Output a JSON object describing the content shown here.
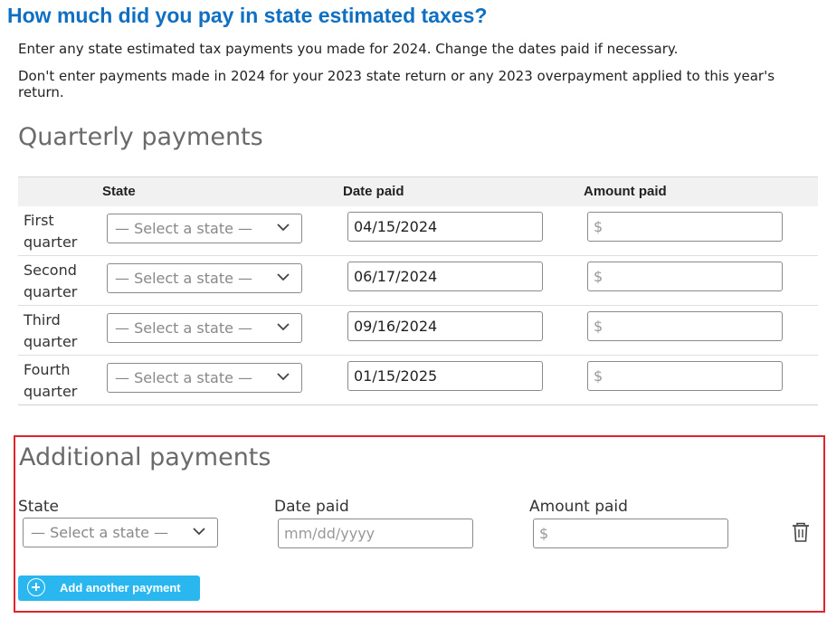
{
  "page": {
    "title": "How much did you pay in state estimated taxes?",
    "intro1": "Enter any state estimated tax payments you made for 2024. Change the dates paid if necessary.",
    "intro2": "Don't enter payments made in 2024 for your 2023 state return or any 2023 overpayment applied to this year's return."
  },
  "quarterly": {
    "title": "Quarterly payments",
    "headers": {
      "state": "State",
      "date": "Date paid",
      "amount": "Amount paid"
    },
    "rows": [
      {
        "label": "First quarter",
        "state": "— Select a state —",
        "date": "04/15/2024",
        "amount": "$"
      },
      {
        "label": "Second quarter",
        "state": "— Select a state —",
        "date": "06/17/2024",
        "amount": "$"
      },
      {
        "label": "Third quarter",
        "state": "— Select a state —",
        "date": "09/16/2024",
        "amount": "$"
      },
      {
        "label": "Fourth quarter",
        "state": "— Select a state —",
        "date": "01/15/2025",
        "amount": "$"
      }
    ]
  },
  "additional": {
    "title": "Additional payments",
    "state_label": "State",
    "date_label": "Date paid",
    "amount_label": "Amount paid",
    "state_value": "— Select a state —",
    "date_placeholder": "mm/dd/yyyy",
    "amount_prefix": "$",
    "add_button": "Add another payment"
  },
  "icons": {
    "dropdown": "chevron-down-icon",
    "delete": "trash-icon",
    "add": "plus-circle-icon"
  },
  "colors": {
    "title": "#0f6fc2",
    "button": "#2ab7f0",
    "highlight_border": "#e0242e"
  }
}
